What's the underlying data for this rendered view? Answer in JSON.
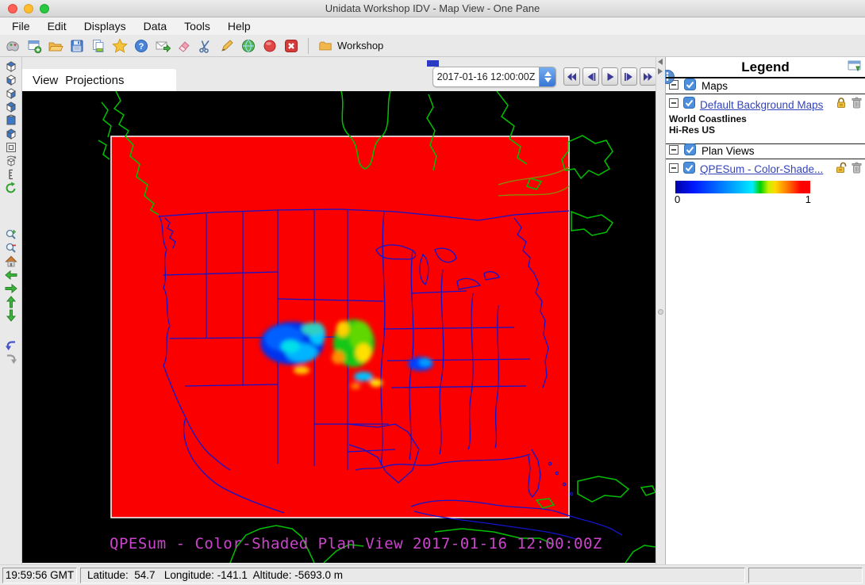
{
  "window": {
    "title": "Unidata Workshop IDV - Map View - One Pane"
  },
  "menubar": {
    "items": [
      "File",
      "Edit",
      "Displays",
      "Data",
      "Tools",
      "Help"
    ]
  },
  "toolbar": {
    "icons": [
      "dashboard-icon",
      "new-window-icon",
      "open-file-icon",
      "save-icon",
      "copy-icon",
      "favorites-icon",
      "help-icon",
      "send-support-icon",
      "erase-displays-icon",
      "cut-icon",
      "edit-icon",
      "globe-icon",
      "stop-loads-icon",
      "exit-icon",
      "folder-icon"
    ],
    "workshop_label": "Workshop"
  },
  "left_toolbar": {
    "icons": [
      "cube-top-view-icon",
      "cube-bottom-view-icon",
      "cube-north-view-icon",
      "cube-east-view-icon",
      "cube-south-view-icon",
      "cube-west-view-icon",
      "wireframe-box-icon",
      "rotate-view-icon",
      "vertical-scale-icon",
      "auto-rotate-icon",
      "zoom-in-icon",
      "zoom-out-icon",
      "home-view-icon",
      "pan-left-icon",
      "pan-right-icon",
      "pan-up-icon",
      "pan-down-icon",
      "undo-icon",
      "redo-icon"
    ]
  },
  "view_menus": {
    "view": "View",
    "projections": "Projections"
  },
  "time_control": {
    "selected_time": "2017-01-16 12:00:00Z",
    "buttons": [
      "go-to-start",
      "step-back",
      "play",
      "step-forward",
      "go-to-end",
      "time-properties"
    ]
  },
  "map": {
    "caption": "QPESum - Color-Shaded Plan View 2017-01-16 12:00:00Z",
    "colors": {
      "background": "#000000",
      "data_fill": "#fa0000",
      "coastline_green": "#00c000",
      "boundaries_blue": "#1414cc",
      "caption_magenta": "#cc44cc"
    }
  },
  "legend": {
    "title": "Legend",
    "maps_group": {
      "label": "Maps",
      "display_link": "Default Background Maps",
      "layers": [
        "World Coastlines",
        "Hi-Res US"
      ]
    },
    "plan_views_group": {
      "label": "Plan Views",
      "display_link": "QPESum - Color-Shade..."
    },
    "colorbar": {
      "min_label": "0",
      "max_label": "1",
      "stops": [
        {
          "c": "#0000a8",
          "p": "0%"
        },
        {
          "c": "#0018ff",
          "p": "14%"
        },
        {
          "c": "#00a0ff",
          "p": "42%"
        },
        {
          "c": "#00ecff",
          "p": "57%"
        },
        {
          "c": "#00d000",
          "p": "63%"
        },
        {
          "c": "#c8f000",
          "p": "69%"
        },
        {
          "c": "#ffd800",
          "p": "74%"
        },
        {
          "c": "#ff7800",
          "p": "83%"
        },
        {
          "c": "#ff0000",
          "p": "93%"
        }
      ]
    }
  },
  "statusbar": {
    "clock": "19:59:56 GMT",
    "position": "Latitude:  54.7   Longitude: -141.1  Altitude: -5693.0 m"
  }
}
